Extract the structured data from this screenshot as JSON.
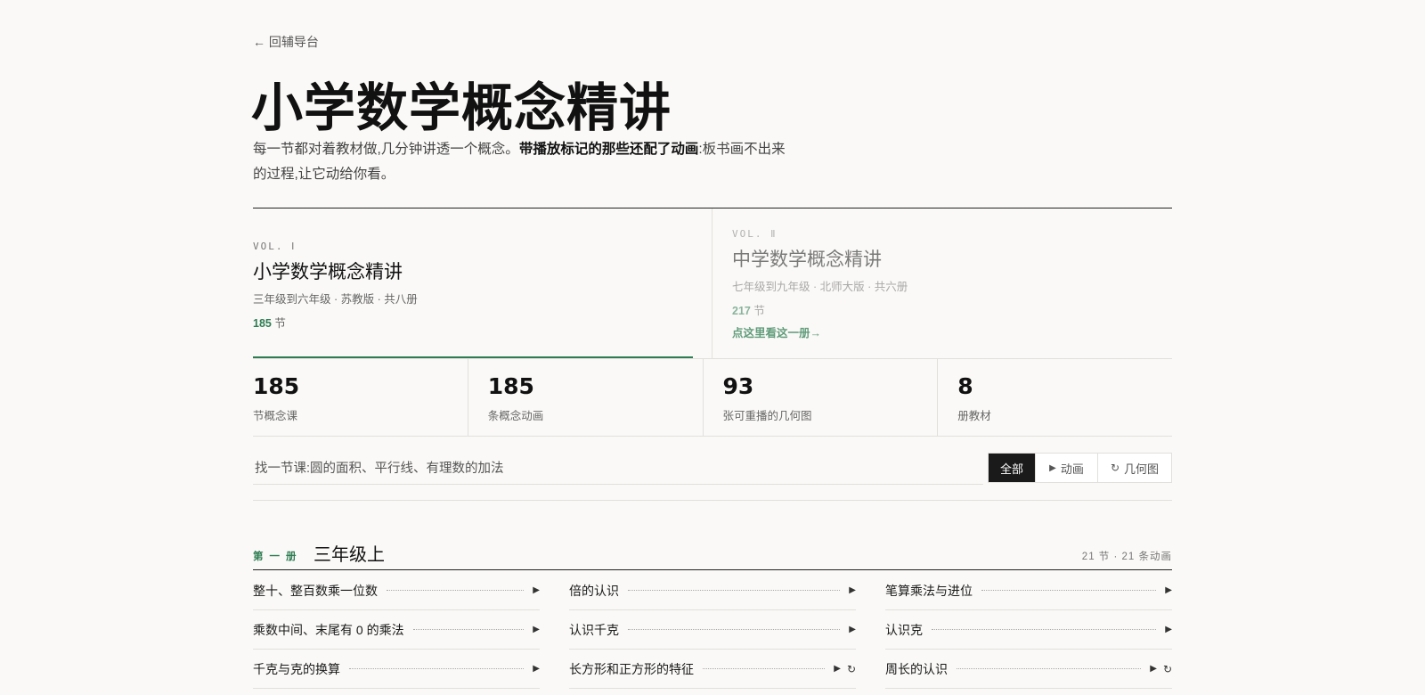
{
  "back_link": "← 回辅导台",
  "page_title": "小学数学概念精讲",
  "intro": {
    "part1": "每一节都对着教材做,几分钟讲透一个概念。",
    "bold": "带播放标记的那些还配了动画",
    "part2": ":板书画不出来的过程,让它动给你看。"
  },
  "volumes": [
    {
      "label": "VOL. Ⅰ",
      "title": "小学数学概念精讲",
      "meta": "三年级到六年级 · 苏教版 · 共八册",
      "count": "185",
      "unit": "节"
    },
    {
      "label": "VOL. Ⅱ",
      "title": "中学数学概念精讲",
      "meta": "七年级到九年级 · 北师大版 · 共六册",
      "count": "217",
      "unit": "节",
      "link": "点这里看这一册→"
    }
  ],
  "stats": [
    {
      "num": "185",
      "label": "节概念课"
    },
    {
      "num": "185",
      "label": "条概念动画"
    },
    {
      "num": "93",
      "label": "张可重播的几何图"
    },
    {
      "num": "8",
      "label": "册教材"
    }
  ],
  "search": {
    "placeholder": "找一节课:圆的面积、平行线、有理数的加法"
  },
  "filters": {
    "all": "全部",
    "anim": "动画",
    "geo": "几何图"
  },
  "icons": {
    "play": "play-icon",
    "geo": "refresh-icon"
  },
  "colors": {
    "accent": "#2e7d52",
    "ink": "#1a1a1a",
    "bg": "#faf9f7"
  },
  "section": {
    "tag": "第一册",
    "title": "三年级上",
    "meta": "21 节 · 21 条动画",
    "lessons": [
      {
        "name": "整十、整百数乘一位数",
        "anim": true,
        "geo": false
      },
      {
        "name": "倍的认识",
        "anim": true,
        "geo": false
      },
      {
        "name": "笔算乘法与进位",
        "anim": true,
        "geo": false
      },
      {
        "name": "乘数中间、末尾有 0 的乘法",
        "anim": true,
        "geo": false
      },
      {
        "name": "认识千克",
        "anim": true,
        "geo": false
      },
      {
        "name": "认识克",
        "anim": true,
        "geo": false
      },
      {
        "name": "千克与克的换算",
        "anim": true,
        "geo": false
      },
      {
        "name": "长方形和正方形的特征",
        "anim": true,
        "geo": true
      },
      {
        "name": "周长的认识",
        "anim": true,
        "geo": true
      }
    ]
  }
}
